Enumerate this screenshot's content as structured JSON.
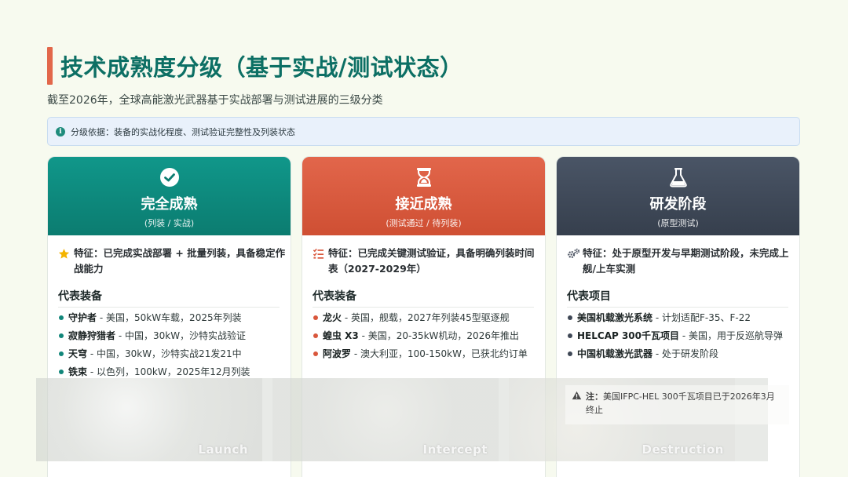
{
  "header": {
    "title": "技术成熟度分级（基于实战/测试状态）",
    "subtitle": "截至2026年，全球高能激光武器基于实战部署与测试进展的三级分类"
  },
  "basis": {
    "icon": "info-icon",
    "text": "分级依据：装备的实战化程度、测试验证完整性及列装状态"
  },
  "cards": [
    {
      "icon": "check-circle-icon",
      "color": "#0b7c70",
      "title": "完全成熟",
      "subtitle": "(列装 / 实战)",
      "feature_icon": "star-icon",
      "feature": "特征：已完成实战部署 + 批量列装，具备稳定作战能力",
      "section": "代表装备",
      "items": [
        {
          "name": "守护者",
          "desc": " - 美国，50kW车载，2025年列装"
        },
        {
          "name": "寂静狩猎者",
          "desc": " - 中国，30kW，沙特实战验证"
        },
        {
          "name": "天穹",
          "desc": " - 中国，30kW，沙特实战21发21中"
        },
        {
          "name": "铁束",
          "desc": " - 以色列，100kW，2025年12月列装"
        }
      ]
    },
    {
      "icon": "hourglass-icon",
      "color": "#cf4f33",
      "title": "接近成熟",
      "subtitle": "(测试通过 / 待列装)",
      "feature_icon": "checklist-icon",
      "feature": "特征：已完成关键测试验证，具备明确列装时间表（2027-2029年）",
      "section": "代表装备",
      "items": [
        {
          "name": "龙火",
          "desc": " - 英国，舰载，2027年列装45型驱逐舰"
        },
        {
          "name": "蝗虫 X3",
          "desc": " - 美国，20-35kW机动，2026年推出"
        },
        {
          "name": "阿波罗",
          "desc": " - 澳大利亚，100-150kW，已获北约订单"
        }
      ]
    },
    {
      "icon": "flask-icon",
      "color": "#363f4d",
      "title": "研发阶段",
      "subtitle": "(原型测试)",
      "feature_icon": "gears-icon",
      "feature": "特征：处于原型开发与早期测试阶段，未完成上舰/上车实测",
      "section": "代表项目",
      "items": [
        {
          "name": "美国机载激光系统",
          "desc": " - 计划适配F-35、F-22"
        },
        {
          "name": "HELCAP 300千瓦项目",
          "desc": " - 美国，用于反巡航导弹"
        },
        {
          "name": "中国机载激光武器",
          "desc": " - 处于研发阶段"
        }
      ]
    }
  ],
  "note": {
    "icon": "warning-icon",
    "label": "注：",
    "text": "美国IFPC-HEL 300千瓦项目已于2026年3月终止"
  },
  "overlay": {
    "panels": [
      "Launch",
      "Intercept",
      "Destruction"
    ]
  }
}
